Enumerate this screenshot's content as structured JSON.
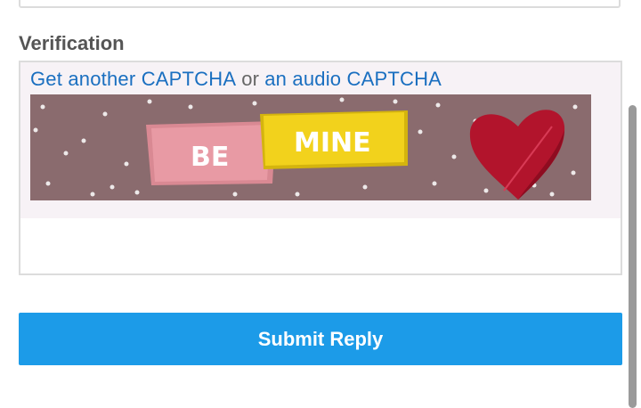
{
  "form": {
    "verification_label": "Verification",
    "captcha": {
      "get_another_link": "Get another CAPTCHA",
      "or_text": "or",
      "audio_link": "an audio CAPTCHA",
      "image_text_1": "BE",
      "image_text_2": "MINE",
      "image_colors": {
        "background": "#8a6b6e",
        "card_pink": "#e89aa4",
        "card_yellow": "#f2d21c",
        "heart": "#b2142c"
      }
    },
    "answer_input": {
      "value": "",
      "placeholder": ""
    },
    "submit_label": "Submit Reply"
  },
  "colors": {
    "link": "#1a6fc0",
    "submit_button": "#1c9be8",
    "border": "#dcdcdc"
  }
}
